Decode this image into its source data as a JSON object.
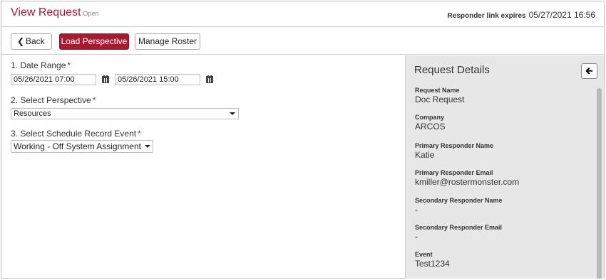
{
  "header": {
    "title": "View Request",
    "status": "Open",
    "expires_label": "Responder link expires",
    "expires_value": "05/27/2021 16:56"
  },
  "toolbar": {
    "back_label": "Back",
    "load_label": "Load Perspective",
    "roster_label": "Manage Roster"
  },
  "form": {
    "date_range": {
      "label": "1. Date Range",
      "required": "*",
      "start": "05/26/2021 07:00",
      "end": "05/26/2021 15:00"
    },
    "perspective": {
      "label": "2. Select Perspective",
      "required": "*",
      "value": "Resources"
    },
    "schedule_event": {
      "label": "3. Select Schedule Record Event",
      "required": "*",
      "value": "Working - Off System Assignment"
    }
  },
  "details": {
    "title": "Request Details",
    "items": [
      {
        "key": "Request Name",
        "value": "Doc Request"
      },
      {
        "key": "Company",
        "value": "ARCOS"
      },
      {
        "key": "Primary Responder Name",
        "value": "Katie"
      },
      {
        "key": "Primary Responder Email",
        "value": "kmiller@rostermonster.com"
      },
      {
        "key": "Secondary Responder Name",
        "value": "-"
      },
      {
        "key": "Secondary Responder Email",
        "value": "-"
      },
      {
        "key": "Event",
        "value": "Test1234"
      }
    ]
  },
  "icons": {
    "back": "chevron-left-icon",
    "calendar": "calendar-icon",
    "dropdown": "caret-down-icon",
    "collapse": "arrow-left-icon"
  },
  "colors": {
    "accent": "#a21c32",
    "panel": "#e7e7e7"
  }
}
